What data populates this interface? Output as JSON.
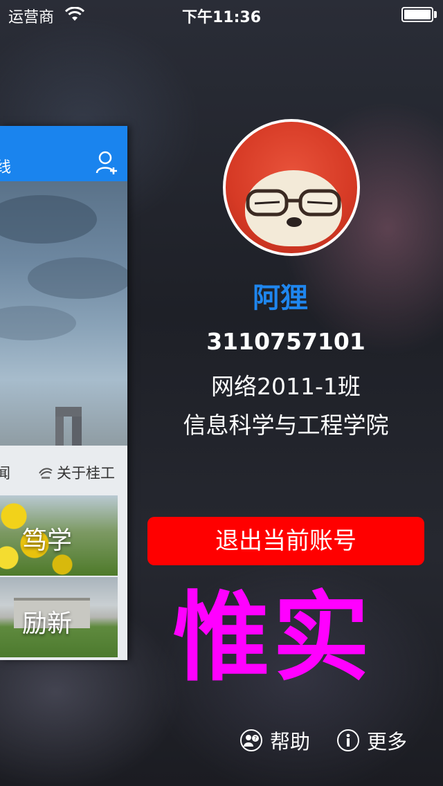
{
  "status_bar": {
    "carrier": "运营商",
    "time": "下午11:36"
  },
  "left_panel": {
    "nav_text": "线",
    "menu_left_text": "闻",
    "menu_about": "关于桂工",
    "tiles": [
      {
        "label": "笃学"
      },
      {
        "label": "励新"
      }
    ]
  },
  "profile": {
    "name": "阿狸",
    "student_id": "3110757101",
    "class_name": "网络2011-1班",
    "college": "信息科学与工程学院"
  },
  "logout_label": "退出当前账号",
  "motto": "惟实",
  "footer": {
    "help_label": "帮助",
    "more_label": "更多"
  },
  "colors": {
    "nav_blue": "#1a84ee",
    "name_blue": "#1f86ee",
    "logout_red": "#ff0000",
    "motto_magenta": "#ff00ff"
  },
  "icons": [
    "wifi-icon",
    "battery-icon",
    "add-user-icon",
    "gut-logo-icon",
    "help-icon",
    "info-icon"
  ]
}
